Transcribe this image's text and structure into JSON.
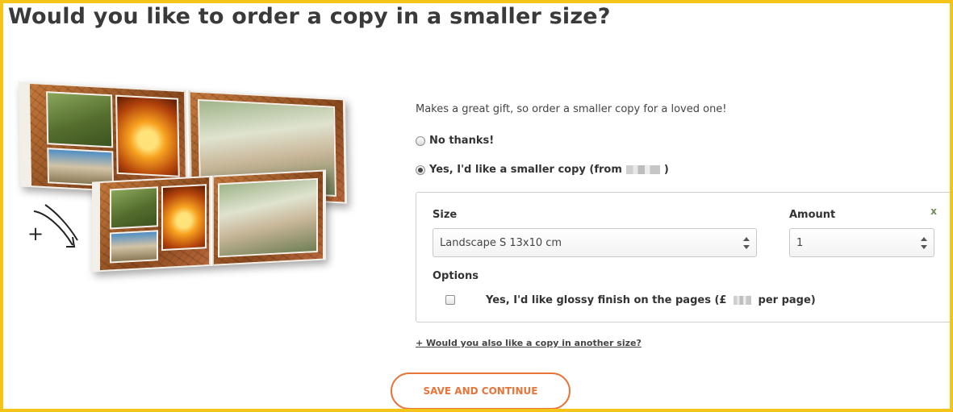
{
  "page": {
    "title": "Would you like to order a copy in a smaller size?"
  },
  "illustration": {
    "description_icon": "photo-book-icon",
    "plus_glyph": "+"
  },
  "offer": {
    "intro": "Makes a great gift, so order a smaller copy for a loved one!",
    "option_no": "No thanks!",
    "option_yes": "Yes, I'd like a smaller copy (from",
    "option_yes_suffix": ")",
    "selected": "yes"
  },
  "copy_panel": {
    "size_label": "Size",
    "size_value": "Landscape S 13x10 cm",
    "amount_label": "Amount",
    "amount_value": "1",
    "close_glyph": "x",
    "options_label": "Options",
    "glossy_prefix": "Yes, I'd like glossy finish on the pages (£",
    "glossy_suffix": "per page)",
    "glossy_checked": false
  },
  "links": {
    "another_size": "+ Would you also like a copy in another size?"
  },
  "actions": {
    "save_label": "SAVE AND CONTINUE"
  },
  "colors": {
    "frame": "#f4c518",
    "accent": "#e9743a"
  }
}
